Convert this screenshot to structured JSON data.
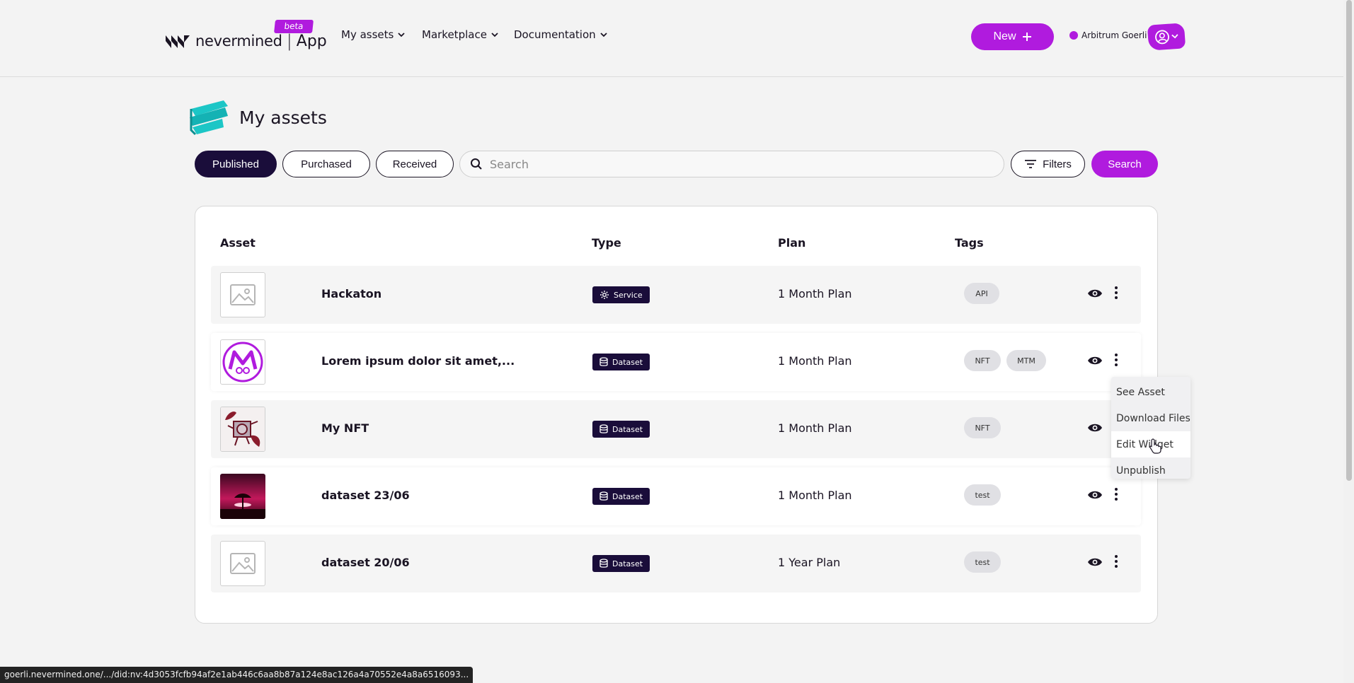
{
  "header": {
    "logo_text": "nevermined",
    "logo_sep": "|",
    "logo_app": "App",
    "beta_label": "beta",
    "nav": [
      {
        "label": "My assets"
      },
      {
        "label": "Marketplace"
      },
      {
        "label": "Documentation"
      }
    ],
    "new_button": "New",
    "network_label": "Arbitrum Goerli"
  },
  "page": {
    "title": "My assets"
  },
  "tabs": [
    {
      "label": "Published",
      "active": true
    },
    {
      "label": "Purchased",
      "active": false
    },
    {
      "label": "Received",
      "active": false
    }
  ],
  "search": {
    "placeholder": "Search",
    "value": "",
    "filters_label": "Filters",
    "search_button": "Search"
  },
  "table": {
    "columns": [
      "Asset",
      "Type",
      "Plan",
      "Tags"
    ],
    "rows": [
      {
        "name": "Hackaton",
        "type": "Service",
        "type_icon": "gear-icon",
        "plan": "1 Month Plan",
        "tags": [
          "API"
        ],
        "thumb": "placeholder-image-icon"
      },
      {
        "name": "Lorem ipsum dolor sit amet,...",
        "type": "Dataset",
        "type_icon": "database-icon",
        "plan": "1 Month Plan",
        "tags": [
          "NFT",
          "MTM"
        ],
        "thumb": "mtm-logo-image"
      },
      {
        "name": "My NFT",
        "type": "Dataset",
        "type_icon": "database-icon",
        "plan": "1 Month Plan",
        "tags": [
          "NFT"
        ],
        "thumb": "nft-artwork-image"
      },
      {
        "name": "dataset 23/06",
        "type": "Dataset",
        "type_icon": "database-icon",
        "plan": "1 Month Plan",
        "tags": [
          "test"
        ],
        "thumb": "sunset-tree-image"
      },
      {
        "name": "dataset 20/06",
        "type": "Dataset",
        "type_icon": "database-icon",
        "plan": "1 Year Plan",
        "tags": [
          "test"
        ],
        "thumb": "placeholder-image-icon"
      }
    ]
  },
  "context_menu": {
    "items": [
      "See Asset",
      "Download Files",
      "Edit Widget",
      "Unpublish"
    ],
    "hovered": "Edit Widget"
  },
  "status_bar": {
    "url": "goerli.nevermined.one/.../did:nv:4d3053fcfb94af2e1ab446c6aa8b87a124e8ac126a4a70552e4a8a6516093..."
  },
  "colors": {
    "accent": "#b01bde",
    "dark": "#1a0d3a",
    "text": "#1a1423"
  }
}
